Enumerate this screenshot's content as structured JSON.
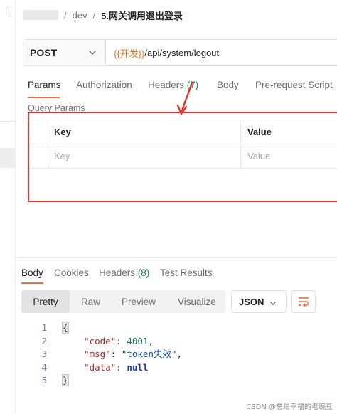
{
  "left_strip": {
    "mark": "⋮"
  },
  "breadcrumb": {
    "separator": "/",
    "folder": "dev",
    "request": "5.网关调用退出登录"
  },
  "request": {
    "method": "POST",
    "url_variable": "{{开发}}",
    "url_path": "/api/system/logout"
  },
  "request_tabs": [
    {
      "label": "Params",
      "count": ""
    },
    {
      "label": "Authorization",
      "count": ""
    },
    {
      "label": "Headers",
      "count": "(7)"
    },
    {
      "label": "Body",
      "count": ""
    },
    {
      "label": "Pre-request Script",
      "count": ""
    }
  ],
  "query_params": {
    "title": "Query Params",
    "headers": [
      "Key",
      "Value"
    ],
    "placeholder": {
      "key": "Key",
      "value": "Value"
    }
  },
  "response_tabs": [
    {
      "label": "Body",
      "count": ""
    },
    {
      "label": "Cookies",
      "count": ""
    },
    {
      "label": "Headers",
      "count": "(8)"
    },
    {
      "label": "Test Results",
      "count": ""
    }
  ],
  "view_modes": [
    "Pretty",
    "Raw",
    "Preview",
    "Visualize"
  ],
  "format_select": "JSON",
  "response_body": {
    "line_numbers": [
      "1",
      "2",
      "3",
      "4",
      "5"
    ],
    "open_brace": "{",
    "close_brace": "}",
    "fields": [
      {
        "key": "\"code\"",
        "value": "4001"
      },
      {
        "key": "\"msg\"",
        "value": "\"token失效\""
      },
      {
        "key": "\"data\"",
        "value": "null"
      }
    ]
  },
  "watermark": "CSDN @总是幸福的老豌豆",
  "colors": {
    "accent_underline": "#f26b3a",
    "variable": "#e8731f",
    "count_green": "#0a8a3d",
    "annotation_red": "#e0312c"
  },
  "icons": {
    "method_dropdown": "chevron-down-icon",
    "format_dropdown": "chevron-down-icon",
    "wrap": "wrap-lines-icon",
    "annotation": "red-arrow-annotation"
  }
}
